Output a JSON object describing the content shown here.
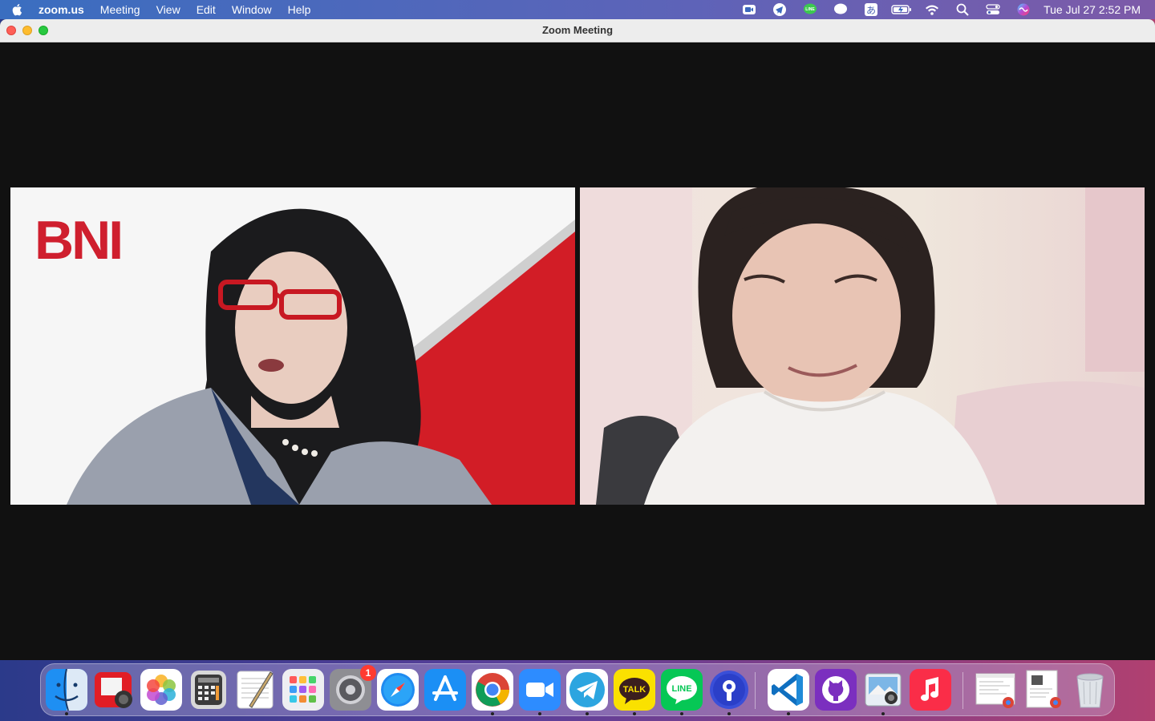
{
  "menubar": {
    "app_name": "zoom.us",
    "menus": [
      "Meeting",
      "View",
      "Edit",
      "Window",
      "Help"
    ],
    "clock": "Tue Jul 27  2:52 PM",
    "tray_icons": [
      "zoom-status-icon",
      "telegram-status-icon",
      "line-status-icon",
      "messages-status-icon",
      "input-method-icon",
      "battery-icon",
      "wifi-icon",
      "spotlight-search-icon",
      "control-center-icon",
      "siri-icon"
    ]
  },
  "window": {
    "title": "Zoom Meeting"
  },
  "participants": [
    {
      "tile": "left",
      "background_logo": "BNI"
    },
    {
      "tile": "right"
    }
  ],
  "dock": {
    "apps": [
      {
        "name": "Finder",
        "icon": "finder-icon",
        "running": true
      },
      {
        "name": "Photo Booth",
        "icon": "photo-booth-icon",
        "running": false
      },
      {
        "name": "Photos",
        "icon": "photos-icon",
        "running": false
      },
      {
        "name": "Calculator",
        "icon": "calculator-icon",
        "running": false
      },
      {
        "name": "TextEdit",
        "icon": "textedit-icon",
        "running": false
      },
      {
        "name": "Launchpad",
        "icon": "launchpad-icon",
        "running": false
      },
      {
        "name": "System Preferences",
        "icon": "system-preferences-icon",
        "running": false,
        "badge": "1"
      },
      {
        "name": "Safari",
        "icon": "safari-icon",
        "running": false
      },
      {
        "name": "App Store",
        "icon": "app-store-icon",
        "running": false
      },
      {
        "name": "Google Chrome",
        "icon": "chrome-icon",
        "running": true
      },
      {
        "name": "Zoom",
        "icon": "zoom-icon",
        "running": true
      },
      {
        "name": "Telegram",
        "icon": "telegram-icon",
        "running": true
      },
      {
        "name": "KakaoTalk",
        "icon": "kakaotalk-icon",
        "running": true,
        "label": "TALK"
      },
      {
        "name": "LINE",
        "icon": "line-icon",
        "running": true,
        "label": "LINE"
      },
      {
        "name": "Keybase",
        "icon": "keybase-icon",
        "running": true
      },
      {
        "name": "Visual Studio Code",
        "icon": "vscode-icon",
        "running": true
      },
      {
        "name": "GitHub Desktop",
        "icon": "github-desktop-icon",
        "running": false
      },
      {
        "name": "Preview",
        "icon": "preview-icon",
        "running": true
      },
      {
        "name": "Music",
        "icon": "music-icon",
        "running": false
      },
      {
        "name": "Chrome Window 1",
        "icon": "chrome-window-thumbnail-icon",
        "running": false
      },
      {
        "name": "Chrome Window 2",
        "icon": "chrome-window-thumbnail-icon",
        "running": false
      },
      {
        "name": "Trash",
        "icon": "trash-icon",
        "running": false
      }
    ]
  }
}
